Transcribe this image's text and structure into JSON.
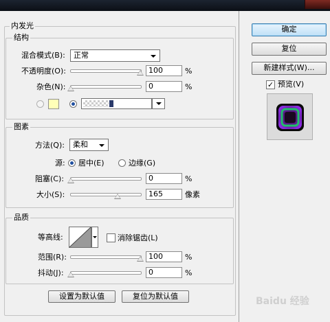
{
  "title_bar": {},
  "inner_glow": {
    "title": "内发光",
    "structure": {
      "title": "结构",
      "blend_mode": {
        "label": "混合模式(B):",
        "value": "正常"
      },
      "opacity": {
        "label": "不透明度(O):",
        "value": "100",
        "unit": "%",
        "slider_fraction": 1.0
      },
      "noise": {
        "label": "杂色(N):",
        "value": "0",
        "unit": "%",
        "slider_fraction": 0.0
      },
      "color_source": {
        "solid_selected": false,
        "gradient_selected": true,
        "swatch_color": "#ffffb8"
      }
    },
    "elements": {
      "title": "图素",
      "technique": {
        "label": "方法(Q):",
        "value": "柔和"
      },
      "source": {
        "label": "源:",
        "center_label": "居中(E)",
        "edge_label": "边缘(G)",
        "selected": "center"
      },
      "choke": {
        "label": "阻塞(C):",
        "value": "0",
        "unit": "%",
        "slider_fraction": 0.0
      },
      "size": {
        "label": "大小(S):",
        "value": "165",
        "unit": "像素",
        "slider_fraction": 0.66
      }
    },
    "quality": {
      "title": "品质",
      "contour": {
        "label": "等高线:",
        "anti_alias_label": "消除锯齿(L)",
        "anti_alias_checked": false
      },
      "range": {
        "label": "范围(R):",
        "value": "100",
        "unit": "%",
        "slider_fraction": 1.0
      },
      "jitter": {
        "label": "抖动(J):",
        "value": "0",
        "unit": "%",
        "slider_fraction": 0.0
      }
    },
    "buttons": {
      "make_default": "设置为默认值",
      "reset_default": "复位为默认值"
    }
  },
  "right_panel": {
    "ok": "确定",
    "reset": "复位",
    "new_style": "新建样式(W)...",
    "preview": {
      "label": "预览(V)",
      "checked": true
    },
    "preview_colors": {
      "glow": "#8a2be2",
      "ring": "#1fbf6a"
    }
  },
  "watermark": "Baidu 经验"
}
